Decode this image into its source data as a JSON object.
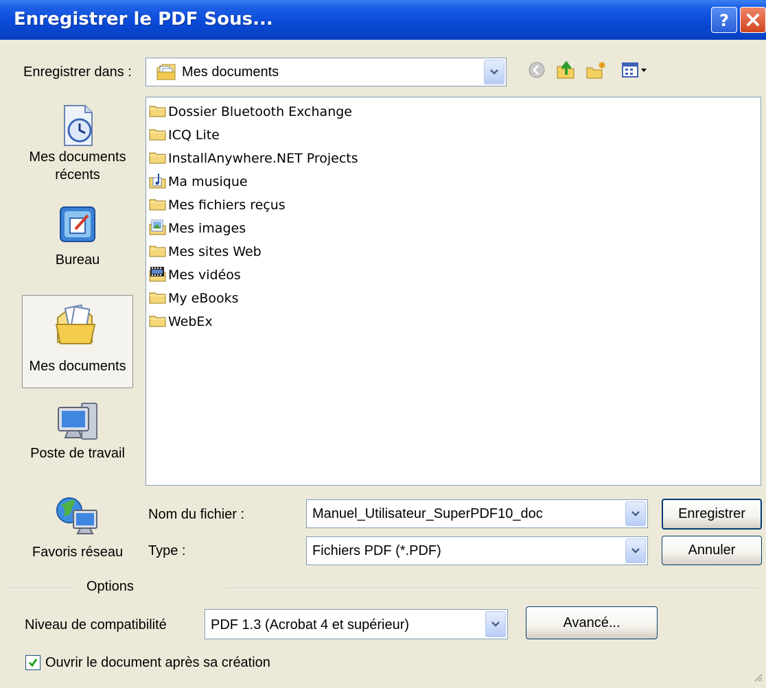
{
  "window": {
    "title": "Enregistrer le PDF Sous...",
    "help_icon": "help-icon",
    "close_icon": "close-icon"
  },
  "toolbar": {
    "save_in_label": "Enregistrer dans :",
    "location": "Mes documents",
    "buttons": [
      "back-icon",
      "up-folder-icon",
      "new-folder-icon",
      "view-menu-icon"
    ]
  },
  "places": [
    {
      "label": "Mes documents récents",
      "icon": "recent-documents-icon"
    },
    {
      "label": "Bureau",
      "icon": "desktop-icon"
    },
    {
      "label": "Mes documents",
      "icon": "my-documents-icon",
      "selected": true
    },
    {
      "label": "Poste de travail",
      "icon": "my-computer-icon"
    },
    {
      "label": "Favoris réseau",
      "icon": "network-places-icon"
    }
  ],
  "files": [
    {
      "name": "Dossier Bluetooth Exchange",
      "icon": "folder-icon"
    },
    {
      "name": "ICQ Lite",
      "icon": "folder-icon"
    },
    {
      "name": "InstallAnywhere.NET Projects",
      "icon": "folder-icon"
    },
    {
      "name": "Ma musique",
      "icon": "music-folder-icon"
    },
    {
      "name": "Mes fichiers reçus",
      "icon": "folder-icon"
    },
    {
      "name": "Mes images",
      "icon": "pictures-folder-icon"
    },
    {
      "name": "Mes sites Web",
      "icon": "folder-icon"
    },
    {
      "name": "Mes vidéos",
      "icon": "videos-folder-icon"
    },
    {
      "name": "My eBooks",
      "icon": "folder-icon"
    },
    {
      "name": "WebEx",
      "icon": "folder-icon"
    }
  ],
  "filename": {
    "label": "Nom du fichier :",
    "value": "Manuel_Utilisateur_SuperPDF10_doc"
  },
  "filetype": {
    "label": "Type :",
    "value": "Fichiers PDF (*.PDF)"
  },
  "buttons": {
    "save": "Enregistrer",
    "cancel": "Annuler",
    "advanced": "Avancé..."
  },
  "options": {
    "heading": "Options",
    "compat_label": "Niveau de compatibilité",
    "compat_value": "PDF 1.3 (Acrobat 4 et supérieur)",
    "open_after_label": "Ouvrir le document après sa création",
    "open_after_checked": true
  },
  "colors": {
    "title_bar": "#0a4ad8",
    "dialog_bg": "#ece9d8",
    "close_button": "#d0461e",
    "folder": "#f5d77a"
  }
}
